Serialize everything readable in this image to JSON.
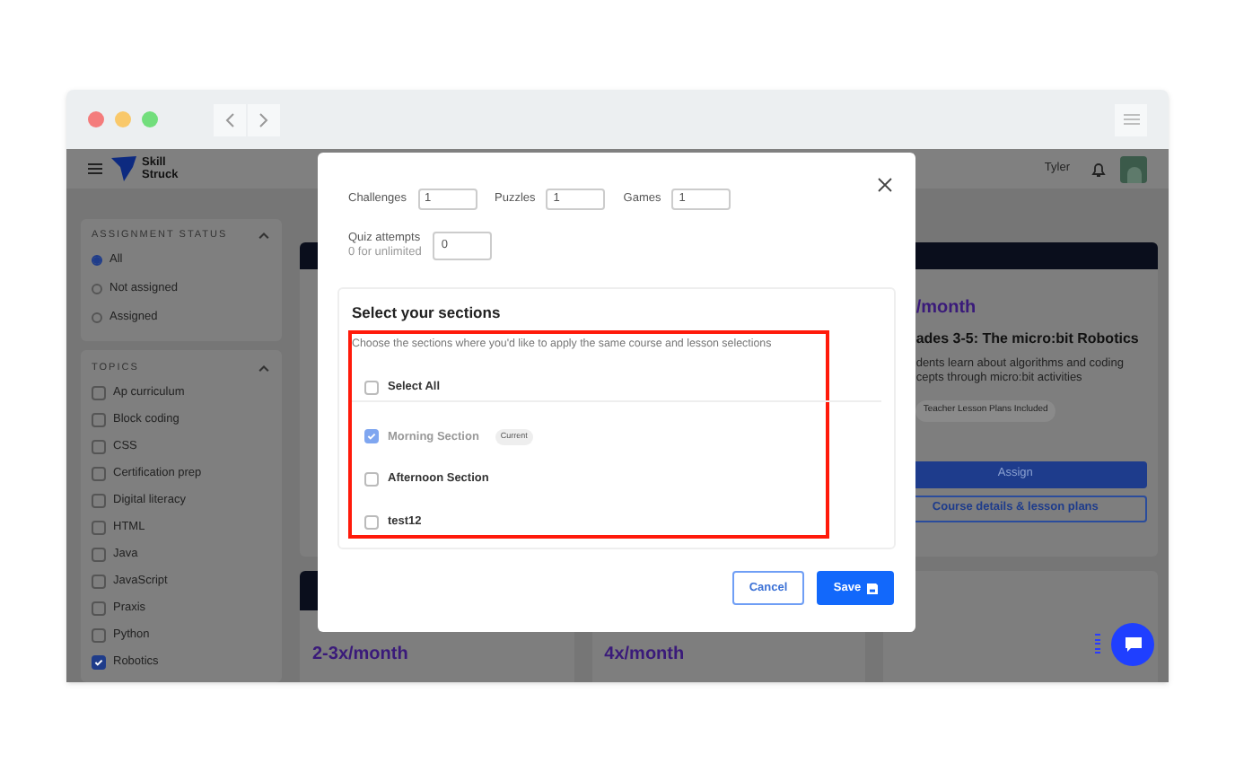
{
  "header": {
    "logo": [
      "Skill",
      "Struck"
    ],
    "user": "Tyler"
  },
  "sidebar": {
    "assignment_status": {
      "title": "ASSIGNMENT STATUS",
      "expanded": true,
      "options": [
        {
          "label": "All",
          "selected": true
        },
        {
          "label": "Not assigned",
          "selected": false
        },
        {
          "label": "Assigned",
          "selected": false
        }
      ]
    },
    "topics": {
      "title": "TOPICS",
      "expanded": true,
      "items": [
        {
          "label": "Ap curriculum",
          "checked": false
        },
        {
          "label": "Block coding",
          "checked": false
        },
        {
          "label": "CSS",
          "checked": false
        },
        {
          "label": "Certification prep",
          "checked": false
        },
        {
          "label": "Digital literacy",
          "checked": false
        },
        {
          "label": "HTML",
          "checked": false
        },
        {
          "label": "Java",
          "checked": false
        },
        {
          "label": "JavaScript",
          "checked": false
        },
        {
          "label": "Praxis",
          "checked": false
        },
        {
          "label": "Python",
          "checked": false
        },
        {
          "label": "Robotics",
          "checked": true
        }
      ]
    }
  },
  "course_card": {
    "frequency": "/month",
    "title": "ades 3-5: The micro:bit Robotics",
    "description": [
      "dents learn about algorithms and coding",
      "cepts through micro:bit activities"
    ],
    "tag": "Teacher Lesson Plans Included",
    "assign": "Assign",
    "details": "Course details & lesson plans"
  },
  "lower_cards": [
    {
      "frequency": "2-3x/month"
    },
    {
      "frequency": "4x/month"
    }
  ],
  "modal": {
    "fields": [
      {
        "label": "Challenges",
        "value": "1"
      },
      {
        "label": "Puzzles",
        "value": "1"
      },
      {
        "label": "Games",
        "value": "1"
      }
    ],
    "quiz": {
      "label": "Quiz attempts",
      "hint": "0 for unlimited",
      "value": "0"
    },
    "sections": {
      "title": "Select your sections",
      "description": "Choose the sections where you'd like to apply the same course and lesson selections",
      "select_all": {
        "label": "Select All",
        "checked": false
      },
      "items": [
        {
          "label": "Morning Section",
          "checked": true,
          "disabled": true,
          "badge": "Current"
        },
        {
          "label": "Afternoon Section",
          "checked": false,
          "disabled": false
        },
        {
          "label": "test12",
          "checked": false,
          "disabled": false
        }
      ]
    },
    "cancel": "Cancel",
    "save": "Save"
  }
}
